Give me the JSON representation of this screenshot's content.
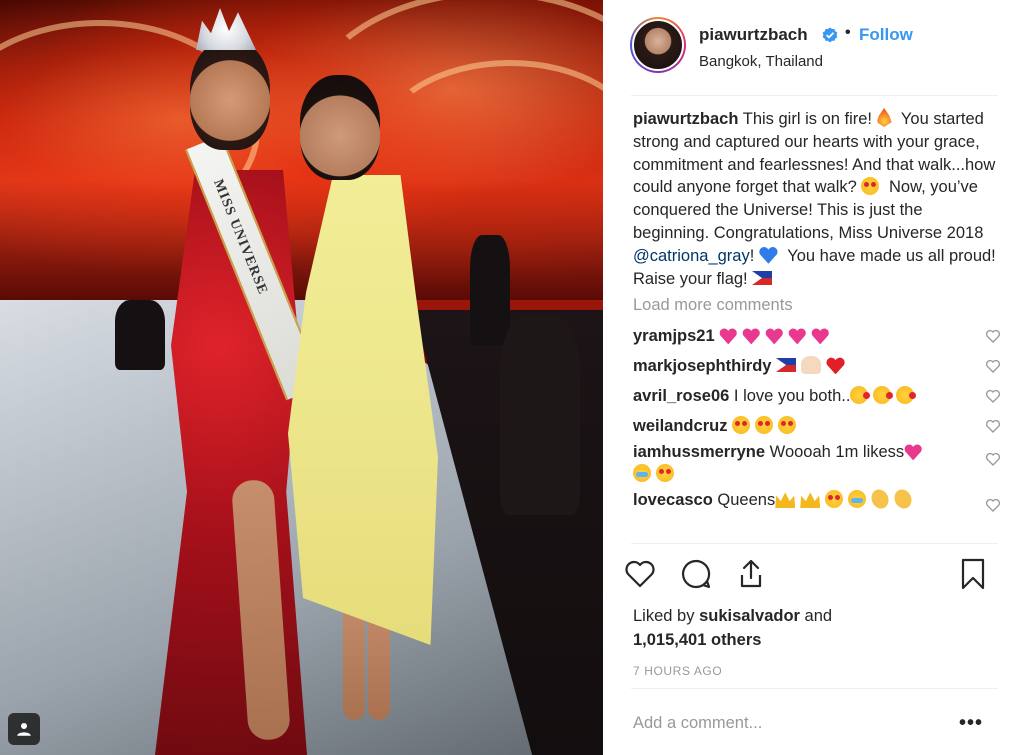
{
  "post": {
    "username": "piawurtzbach",
    "follow_label": "Follow",
    "location": "Bangkok, Thailand",
    "sash_text": "MISS UNIVERSE",
    "caption": {
      "username": "piawurtzbach",
      "part1": "This girl is on fire!",
      "part2": "You started strong and captured our hearts with your grace, commitment and fearlessnes! And that walk...how could anyone forget that walk?",
      "part3": "Now, you’ve conquered the Universe! This is just the beginning. Congratulations, Miss Universe 2018",
      "mention": "@catriona_gray",
      "part4": "!",
      "part5": "You have made us all proud! Raise your flag!"
    },
    "load_more": "Load more comments",
    "comments": [
      {
        "user": "yramjps21",
        "text": ""
      },
      {
        "user": "markjosephthirdy",
        "text": ""
      },
      {
        "user": "avril_rose06",
        "text": "I love you both.."
      },
      {
        "user": "weilandcruz",
        "text": ""
      },
      {
        "user": "iamhussmerryne",
        "text": "Woooah 1m likess"
      },
      {
        "user": "lovecasco",
        "text": "Queens"
      }
    ],
    "likes_prefix": "Liked by",
    "liked_by_user": "sukisalvador",
    "likes_mid": "and",
    "likes_count": "1,015,401 others",
    "timestamp": "7 HOURS AGO",
    "comment_placeholder": "Add a comment...",
    "more_label": "•••"
  },
  "colors": {
    "link_blue": "#3897f0",
    "mention_blue": "#003569",
    "text_dark": "#262626",
    "text_gray": "#999999"
  }
}
